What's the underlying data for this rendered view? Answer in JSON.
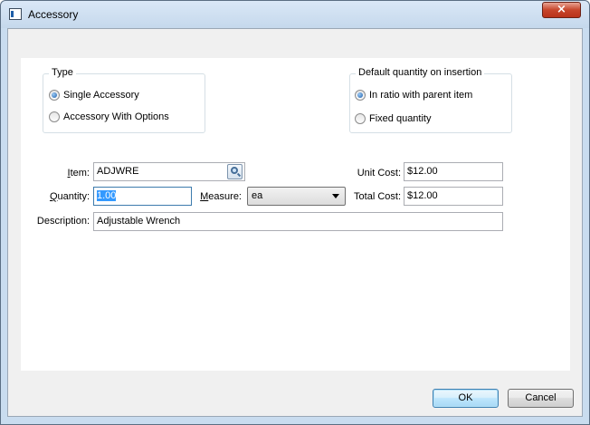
{
  "window": {
    "title": "Accessory",
    "icon": "app-window-icon",
    "close_icon": "close-icon",
    "close_glyph": "×"
  },
  "type_group": {
    "title": "Type",
    "options": [
      {
        "label": "Single Accessory",
        "checked": true
      },
      {
        "label": "Accessory With Options",
        "checked": false
      }
    ]
  },
  "default_qty_group": {
    "title": "Default quantity on insertion",
    "options": [
      {
        "label": "In ratio with parent item",
        "checked": true
      },
      {
        "label": "Fixed quantity",
        "checked": false
      }
    ]
  },
  "form": {
    "item_label_mnemonic": "I",
    "item_label_rest": "tem:",
    "item_value": "ADJWRE",
    "lookup_icon": "search-icon",
    "quantity_label_mnemonic": "Q",
    "quantity_label_rest": "uantity:",
    "quantity_value": "1.00",
    "measure_label_mnemonic": "M",
    "measure_label_rest": "easure:",
    "measure_value": "ea",
    "unit_cost_label": "Unit Cost:",
    "unit_cost_value": "$12.00",
    "total_cost_label": "Total Cost:",
    "total_cost_value": "$12.00",
    "description_label": "Description:",
    "description_value": "Adjustable Wrench"
  },
  "buttons": {
    "ok": "OK",
    "cancel": "Cancel"
  }
}
